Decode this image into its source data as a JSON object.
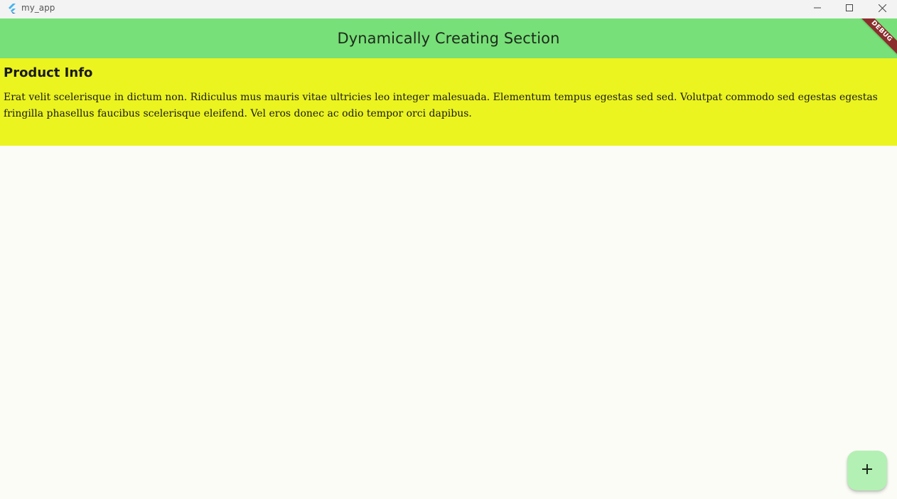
{
  "window": {
    "title": "my_app",
    "controls": {
      "minimize_icon": "minimize-icon",
      "maximize_icon": "maximize-icon",
      "close_icon": "close-icon"
    }
  },
  "appbar": {
    "title": "Dynamically Creating Section",
    "debug_banner": "DEBUG",
    "color": "#78e078"
  },
  "section": {
    "title": "Product Info",
    "body": "Erat velit scelerisque in dictum non. Ridiculus mus mauris vitae ultricies leo integer malesuada. Elementum tempus egestas sed sed. Volutpat commodo sed egestas egestas fringilla phasellus faucibus scelerisque eleifend. Vel eros donec ac odio tempor orci dapibus.",
    "color": "#ebf41f"
  },
  "fab": {
    "icon": "plus-icon",
    "color": "#b3f0b3"
  }
}
